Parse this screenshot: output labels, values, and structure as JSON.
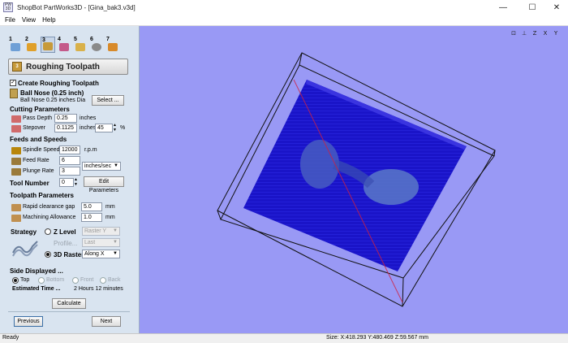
{
  "window": {
    "title": "ShopBot PartWorks3D - [Gina_bak3.v3d]",
    "app_icon_text": "PW 3D",
    "controls": {
      "minimize": "—",
      "maximize": "☐",
      "close": "✕"
    }
  },
  "menu": {
    "items": [
      "File",
      "View",
      "Help"
    ]
  },
  "toolbar": {
    "steps": [
      "1",
      "2",
      "3",
      "4",
      "5",
      "6",
      "7"
    ]
  },
  "panel": {
    "header_icon": "3",
    "title": "Roughing Toolpath",
    "create_label": "Create Roughing Toolpath",
    "create_checked": true,
    "tool_name": "Ball Nose (0.25 inch)",
    "tool_desc": "Ball Nose 0.25 inches Dia",
    "select_button": "Select ...",
    "cutting_header": "Cutting Parameters",
    "pass_depth_label": "Pass Depth",
    "pass_depth_value": "0.25",
    "pass_depth_unit": "inches",
    "stepover_label": "Stepover",
    "stepover_value": "0.1125",
    "stepover_unit": "inches",
    "stepover_percent": "45",
    "percent_sign": "%",
    "feeds_header": "Feeds and Speeds",
    "spindle_label": "Spindle Speed",
    "spindle_value": "12000",
    "spindle_unit": "r.p.m",
    "feed_label": "Feed Rate",
    "feed_value": "6",
    "rate_unit": "inches/sec",
    "plunge_label": "Plunge Rate",
    "plunge_value": "3",
    "tool_number_label": "Tool Number",
    "tool_number_value": "0",
    "edit_button": "Edit Parameters",
    "toolpath_header": "Toolpath Parameters",
    "rapid_label": "Rapid clearance gap",
    "rapid_value": "5.0",
    "rapid_unit": "mm",
    "allowance_label": "Machining Allowance",
    "allowance_value": "1.0",
    "allowance_unit": "mm",
    "strategy_label": "Strategy",
    "zlevel_label": "Z Level",
    "zlevel_option": "Raster Y",
    "profile_label": "Profile...",
    "profile_option": "Last",
    "raster_label": "3D Raster",
    "raster_option": "Along X",
    "side_header": "Side Displayed ...",
    "side_options": [
      "Top",
      "Bottom",
      "Front",
      "Back"
    ],
    "side_selected": "Top",
    "estimated_label": "Estimated Time ...",
    "estimated_value": "2 Hours 12 minutes",
    "calculate_button": "Calculate",
    "previous_button": "Previous",
    "next_button": "Next"
  },
  "viewport": {
    "background": "#9999f5",
    "model_color": "#1a14c8",
    "box_color": "#111111",
    "icons": [
      "zoom-fit-icon",
      "view-iso-icon",
      "view-z-icon",
      "view-x-icon",
      "view-y-icon"
    ],
    "icon_labels": [
      "⊡",
      "⊥",
      "Z",
      "X",
      "Y"
    ]
  },
  "status": {
    "left": "Ready",
    "size": "Size: X:418.293 Y:480.469 Z:59.567 mm"
  }
}
